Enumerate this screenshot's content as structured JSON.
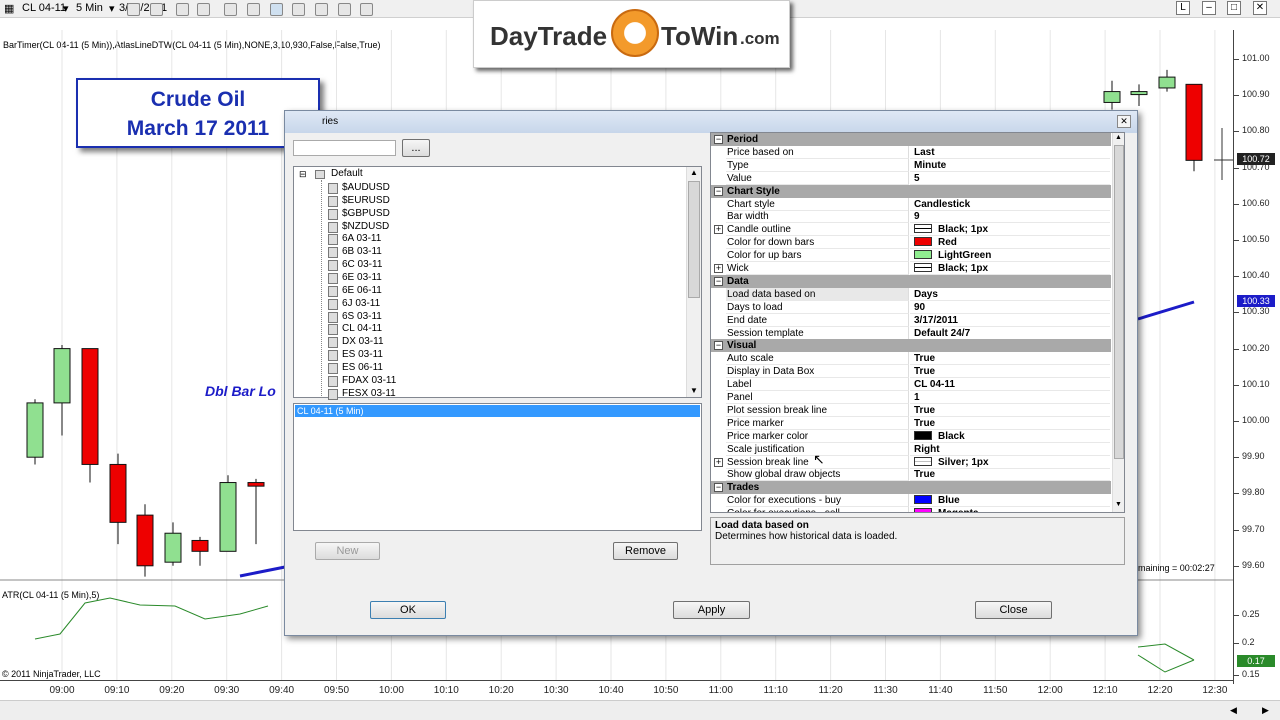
{
  "toolbar": {
    "instrument": "CL 04-11",
    "interval": "5 Min",
    "date": "3/17/2011",
    "window_buttons": [
      "L",
      "–",
      "□",
      "✕"
    ]
  },
  "chart": {
    "indicator_line": "BarTimer(CL 04-11 (5 Min)),AtlasLineDTW(CL 04-11 (5 Min),NONE,3,10,930,False,False,True)",
    "annotation": "Dbl Bar Lo",
    "bar_timer": "maining = 00:02:27",
    "atr_label": "ATR(CL 04-11 (5 Min),5)",
    "copyright": "© 2011 NinjaTrader, LLC",
    "price_ticks": [
      "101.00",
      "100.90",
      "100.80",
      "100.70",
      "100.60",
      "100.50",
      "100.40",
      "100.30",
      "100.20",
      "100.10",
      "100.00",
      "99.90",
      "99.80",
      "99.70",
      "99.60"
    ],
    "price_box_last": "100.72",
    "price_box_line": "100.33",
    "atr_ticks": [
      "0.25",
      "0.2",
      "0.15"
    ],
    "atr_box": "0.17",
    "time_ticks": [
      "09:00",
      "09:10",
      "09:20",
      "09:30",
      "09:40",
      "09:50",
      "10:00",
      "10:10",
      "10:20",
      "10:30",
      "10:40",
      "10:50",
      "11:00",
      "11:10",
      "11:20",
      "11:30",
      "11:40",
      "11:50",
      "12:00",
      "12:10",
      "12:20",
      "12:30"
    ],
    "colors": {
      "up": "#90e090",
      "down": "#ee0000",
      "line": "#1c1cc8",
      "atr": "#2a8a2a"
    }
  },
  "logo": {
    "part1": "DayTrade",
    "part2": "ToWin",
    "part3": ".com"
  },
  "title_box": {
    "line1": "Crude Oil",
    "line2": "March 17 2011"
  },
  "dialog": {
    "title": "ries",
    "browse_button": "...",
    "tree_root": "Default",
    "instruments": [
      "$AUDUSD",
      "$EURUSD",
      "$GBPUSD",
      "$NZDUSD",
      "6A 03-11",
      "6B 03-11",
      "6C 03-11",
      "6E 03-11",
      "6E 06-11",
      "6J 03-11",
      "6S 03-11",
      "CL 04-11",
      "DX 03-11",
      "ES 03-11",
      "ES 06-11",
      "FDAX 03-11",
      "FESX 03-11"
    ],
    "selected_series": "CL 04-11 (5 Min)",
    "new_button": "New",
    "remove_button": "Remove",
    "ok_button": "OK",
    "apply_button": "Apply",
    "close_button": "Close",
    "properties": [
      {
        "cat": "Period"
      },
      {
        "k": "Price based on",
        "v": "Last"
      },
      {
        "k": "Type",
        "v": "Minute"
      },
      {
        "k": "Value",
        "v": "5"
      },
      {
        "cat": "Chart Style"
      },
      {
        "k": "Chart style",
        "v": "Candlestick"
      },
      {
        "k": "Bar width",
        "v": "9"
      },
      {
        "k": "Candle outline",
        "v": "Black; 1px",
        "plus": true,
        "sw": "line"
      },
      {
        "k": "Color for down bars",
        "v": "Red",
        "sw": "#ee0000"
      },
      {
        "k": "Color for up bars",
        "v": "LightGreen",
        "sw": "#90ee90"
      },
      {
        "k": "Wick",
        "v": "Black; 1px",
        "plus": true,
        "sw": "line"
      },
      {
        "cat": "Data"
      },
      {
        "k": "Load data based on",
        "v": "Days",
        "sel": true
      },
      {
        "k": "Days to load",
        "v": "90"
      },
      {
        "k": "End date",
        "v": "3/17/2011"
      },
      {
        "k": "Session template",
        "v": "Default 24/7"
      },
      {
        "cat": "Visual"
      },
      {
        "k": "Auto scale",
        "v": "True"
      },
      {
        "k": "Display in Data Box",
        "v": "True"
      },
      {
        "k": "Label",
        "v": "CL 04-11"
      },
      {
        "k": "Panel",
        "v": "1"
      },
      {
        "k": "Plot session break line",
        "v": "True"
      },
      {
        "k": "Price marker",
        "v": "True"
      },
      {
        "k": "Price marker color",
        "v": "Black",
        "sw": "#000000"
      },
      {
        "k": "Scale justification",
        "v": "Right"
      },
      {
        "k": "Session break line",
        "v": "Silver; 1px",
        "plus": true,
        "sw": "silverline"
      },
      {
        "k": "Show global draw objects",
        "v": "True"
      },
      {
        "cat": "Trades"
      },
      {
        "k": "Color for executions - buy",
        "v": "Blue",
        "sw": "#0000ff"
      },
      {
        "k": "Color for executions - sell",
        "v": "Magenta",
        "sw": "#ff00ff"
      }
    ],
    "description_title": "Load data based on",
    "description_text": "Determines how historical data is loaded."
  }
}
